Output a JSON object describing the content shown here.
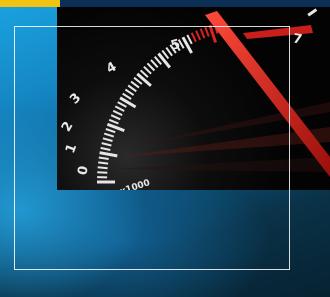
{
  "colors": {
    "accent_yellow": "#f3c313",
    "top_bar": "#0c2f55",
    "needle_red": "#d8231f",
    "gauge_face": "#050608",
    "frame": "#ffffff"
  },
  "gauge": {
    "scale_labels": [
      "0",
      "1",
      "2",
      "3",
      "4",
      "5",
      "7"
    ],
    "multiplier": "x1000"
  }
}
